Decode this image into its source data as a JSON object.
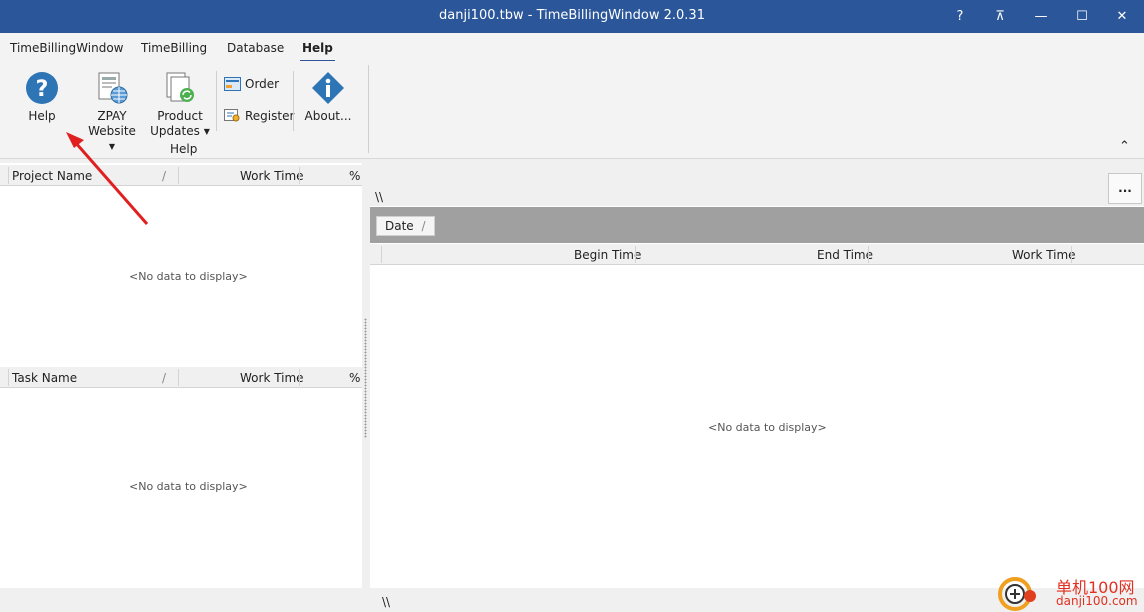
{
  "window": {
    "title": "danji100.tbw - TimeBillingWindow 2.0.31",
    "buttons": {
      "help": "?",
      "restore": "⊼",
      "minimize": "—",
      "maximize": "☐",
      "close": "✕"
    }
  },
  "menu": {
    "tabs": [
      "TimeBillingWindow",
      "TimeBilling",
      "Database",
      "Help"
    ],
    "active_tab": "Help"
  },
  "ribbon": {
    "help_label": "Help",
    "zpay_line1": "ZPAY",
    "zpay_line2": "Website",
    "updates_line1": "Product",
    "updates_line2": "Updates",
    "order_label": "Order",
    "register_label": "Register",
    "about_label": "About...",
    "group_label": "Help",
    "collapse_glyph": "⌃"
  },
  "projects_grid": {
    "columns": [
      "Project Name",
      "Work Time",
      "%"
    ],
    "sort_glyph": "/",
    "empty_text": "<No data to display>"
  },
  "tasks_grid": {
    "columns": [
      "Task Name",
      "Work Time",
      "%"
    ],
    "sort_glyph": "/",
    "empty_text": "<No data to display>"
  },
  "entries": {
    "path_text": "\\\\",
    "more_button": "...",
    "group_chip": "Date",
    "group_sort_glyph": "/",
    "columns": [
      "Begin Time",
      "End Time",
      "Work Time"
    ],
    "empty_text": "<No data to display>"
  },
  "statusbar": {
    "text": "\\\\"
  },
  "watermark": {
    "cn": "单机100网",
    "url": "danji100.com"
  },
  "colors": {
    "titlebar": "#2b579a",
    "annotation_arrow": "#e02020",
    "help_icon": "#2e75b6"
  }
}
